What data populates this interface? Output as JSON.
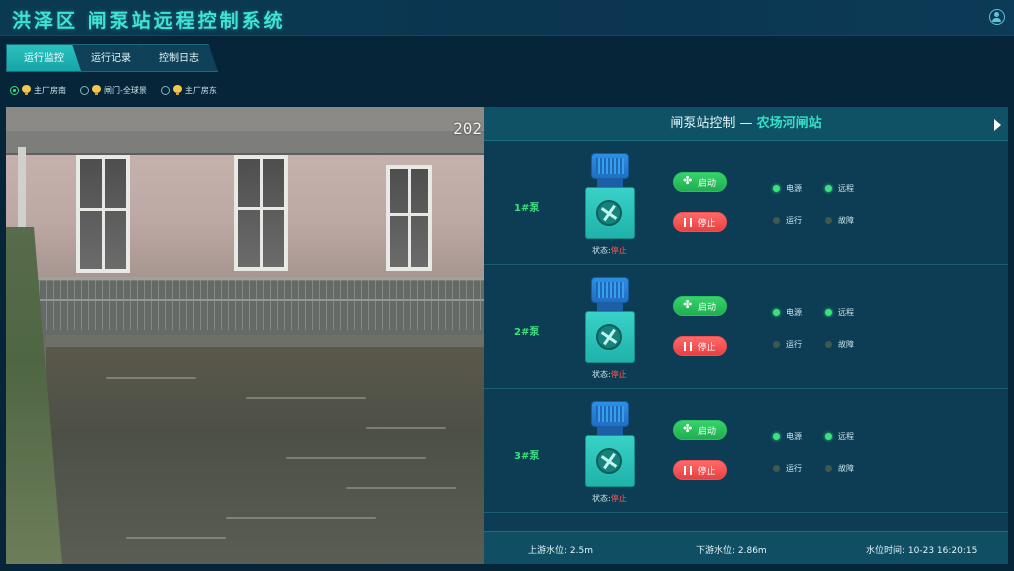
{
  "header": {
    "title": "洪泽区 闸泵站远程控制系统"
  },
  "tabs": [
    {
      "label": "运行监控",
      "active": true
    },
    {
      "label": "运行记录",
      "active": false
    },
    {
      "label": "控制日志",
      "active": false
    }
  ],
  "cameras": [
    {
      "label": "主厂房南",
      "selected": true
    },
    {
      "label": "闸门-全球景",
      "selected": false
    },
    {
      "label": "主厂房东",
      "selected": false
    }
  ],
  "camera_view": {
    "timestamp": "202"
  },
  "panel": {
    "title_prefix": "闸泵站控制 — ",
    "station": "农场河闸站"
  },
  "pumps": [
    {
      "name": "1#泵",
      "start_label": "启动",
      "stop_label": "停止",
      "status_label": "状态:",
      "status": "停止",
      "indicators": {
        "power": "电源",
        "remote": "远程",
        "run": "运行",
        "fault": "故障"
      }
    },
    {
      "name": "2#泵",
      "start_label": "启动",
      "stop_label": "停止",
      "status_label": "状态:",
      "status": "停止",
      "indicators": {
        "power": "电源",
        "remote": "远程",
        "run": "运行",
        "fault": "故障"
      }
    },
    {
      "name": "3#泵",
      "start_label": "启动",
      "stop_label": "停止",
      "status_label": "状态:",
      "status": "停止",
      "indicators": {
        "power": "电源",
        "remote": "远程",
        "run": "运行",
        "fault": "故障"
      }
    }
  ],
  "water": {
    "upstream": "上游水位: 2.5m",
    "downstream": "下游水位: 2.86m",
    "time": "水位时间: 10-23 16:20:15"
  },
  "colors": {
    "accent": "#35e0c8",
    "ok": "#3de07f",
    "stop": "#e84040",
    "start": "#1fae4f"
  }
}
